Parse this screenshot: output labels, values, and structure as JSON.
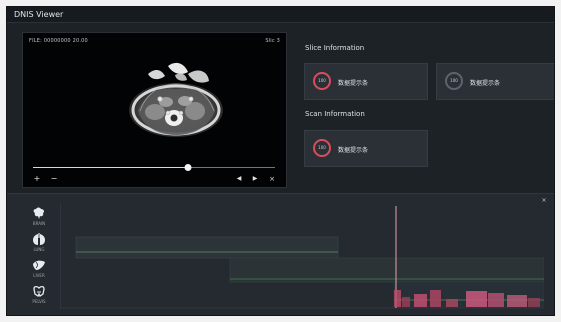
{
  "app": {
    "title": "DNIS Viewer"
  },
  "viewer": {
    "file_label": "FILE: 00000000 20.00",
    "slice_label": "Slic 3",
    "progress": 0.64,
    "controls": {
      "add": "+",
      "minus": "−",
      "previous": "◀",
      "next": "▶",
      "close": "×"
    }
  },
  "slice_info": {
    "title": "Slice Information",
    "cards": [
      {
        "ring_text": "100",
        "label": "数据提示条"
      },
      {
        "ring_text": "100",
        "label": "数据提示条"
      }
    ]
  },
  "scan_info": {
    "title": "Scan Information",
    "cards": [
      {
        "ring_text": "100",
        "label": "数据提示条"
      }
    ]
  },
  "organs": [
    {
      "icon": "brain-icon",
      "label": "BRAIN"
    },
    {
      "icon": "lung-icon",
      "label": "LUNG"
    },
    {
      "icon": "liver-icon",
      "label": "LIVER"
    },
    {
      "icon": "pelvis-icon",
      "label": "PELVIS"
    }
  ],
  "panel": {
    "button": "×"
  },
  "colors": {
    "accent_red": "#d94d5c",
    "accent_green": "#64b66d",
    "panel_bg": "#242a30",
    "card_bg": "#2a3036",
    "timeline_green": "#315d3f"
  }
}
